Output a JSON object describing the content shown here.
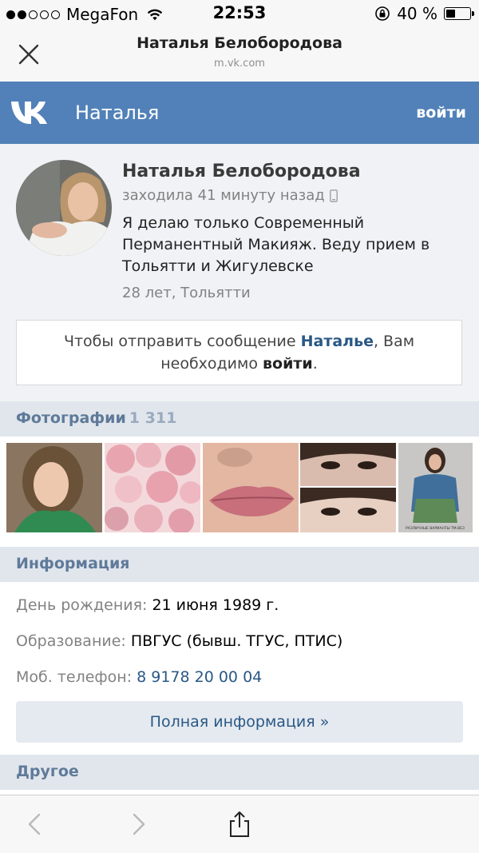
{
  "status_bar": {
    "carrier": "MegaFon",
    "signal_bars": 2,
    "time": "22:53",
    "battery": "40 %",
    "battery_level": 0.4
  },
  "browser": {
    "title": "Наталья Белобородова",
    "url": "m.vk.com"
  },
  "vk_header": {
    "logo": "vk-logo",
    "name": "Наталья",
    "login_label": "войти",
    "color": "#5181b8"
  },
  "profile": {
    "name": "Наталья Белобородова",
    "last_seen": "заходила 41 минуту назад",
    "status_lines": [
      "Я делаю только Современный",
      "Перманентный Макияж. Веду прием в",
      "Тольятти и Жигулевске"
    ],
    "age_city": "28 лет, Тольятти",
    "message_prefix": "Чтобы отправить сообщение",
    "message_name": "Наталье",
    "message_mid": ", Вам",
    "message_line2_prefix": "необходимо",
    "message_login": "войти",
    "message_end": "."
  },
  "photos": {
    "title": "Фотографии",
    "count": "1 311",
    "caption_last": "РАЗЛИЧНЫЕ ВАРИАНТЫ ТМ.ВЕЗ"
  },
  "info": {
    "title": "Информация",
    "birthday_label": "День рождения:",
    "birthday_value": "21 июня 1989 г.",
    "education_label": "Образование:",
    "education_value": "ПВГУС (бывш. ТГУС, ПТИС)",
    "phone_label": "Моб. телефон:",
    "phone_value": "8 9178 20 00 04",
    "full_button": "Полная информация »"
  },
  "other": {
    "title": "Другое"
  },
  "toolbar": {
    "back": "chevron-left-icon",
    "forward": "chevron-right-icon",
    "share": "share-icon"
  }
}
